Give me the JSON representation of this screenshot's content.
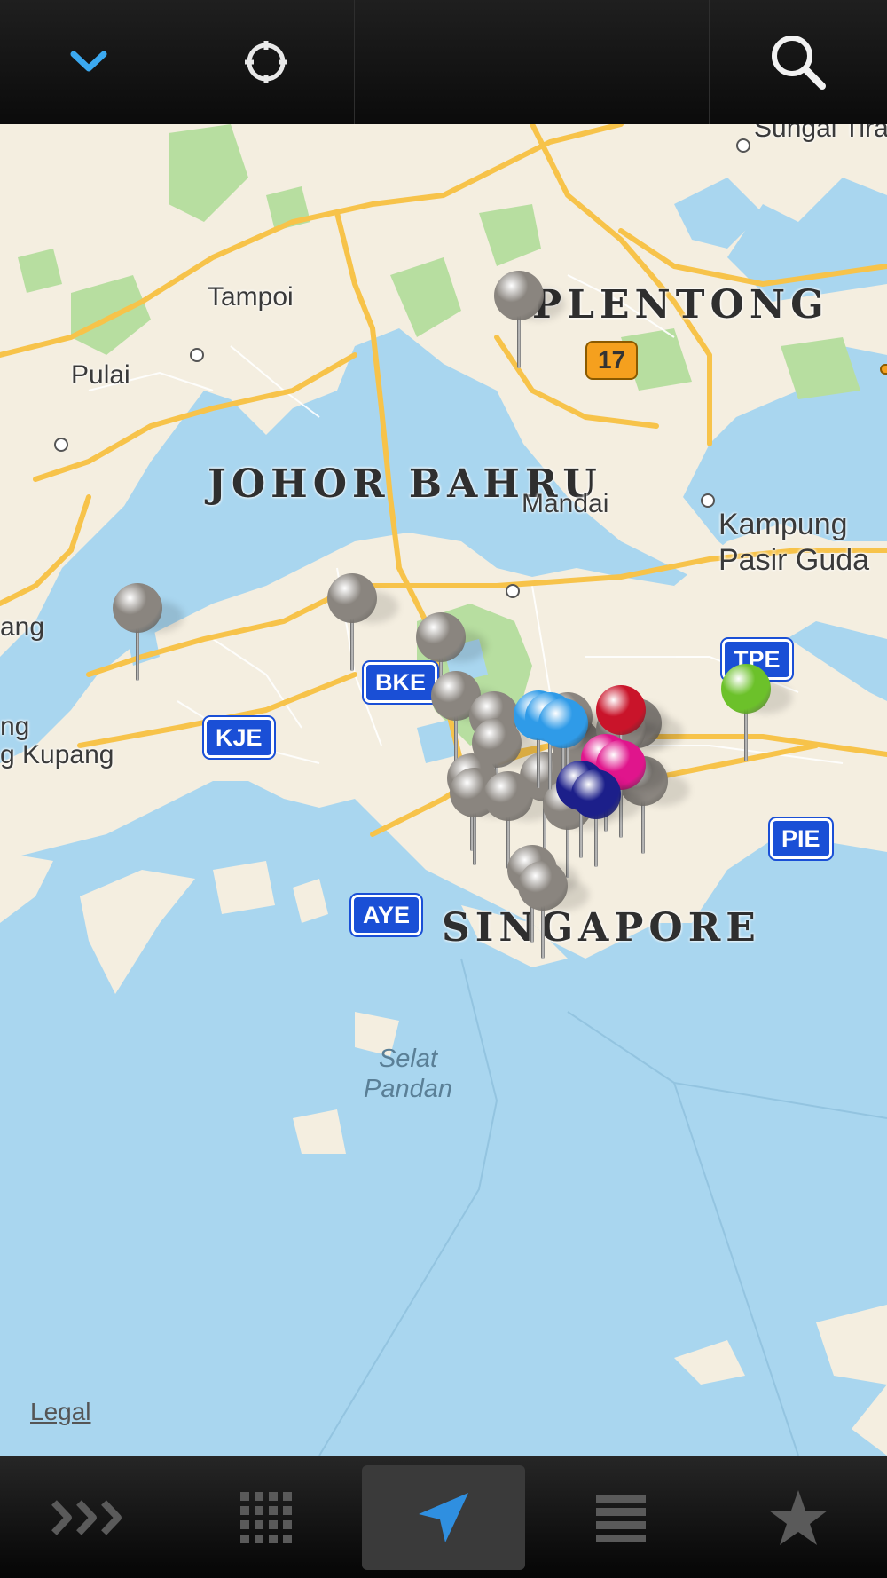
{
  "toolbar": {
    "collapse_icon": "chevron-down-icon",
    "locate_icon": "crosshair-icon",
    "search_icon": "search-icon",
    "accent": "#3ba9f0"
  },
  "map": {
    "place_labels": {
      "plentong": "PLENTONG",
      "johor_bahru": "JOHOR BAHRU",
      "singapore": "SINGAPORE",
      "tampoi": "Tampoi",
      "pulai": "Pulai",
      "mandai": "Mandai",
      "kampung_1": "Kampung",
      "kampung_2": "Pasir Guda",
      "sungai": "Sungai Tira",
      "ang": "ang",
      "ng": "ng",
      "kupang": "g Kupang"
    },
    "water_labels": {
      "selat_1": "Selat",
      "selat_2": "Pandan"
    },
    "route_shields": {
      "kje": "KJE",
      "bke": "BKE",
      "tpe": "TPE",
      "pie": "PIE",
      "aye": "AYE",
      "r17": "17"
    },
    "legal": "Legal",
    "pin_colors": {
      "gray": "#8a857f",
      "blue": "#2f9be8",
      "red": "#c9142a",
      "magenta": "#e0158c",
      "navy": "#1c1f8a",
      "green": "#6cc12a"
    }
  },
  "tabbar": {
    "tabs": [
      {
        "icon": "triple-chevron-right-icon"
      },
      {
        "icon": "grid-icon"
      },
      {
        "icon": "location-arrow-icon",
        "active": true
      },
      {
        "icon": "list-icon"
      },
      {
        "icon": "star-icon"
      }
    ]
  }
}
